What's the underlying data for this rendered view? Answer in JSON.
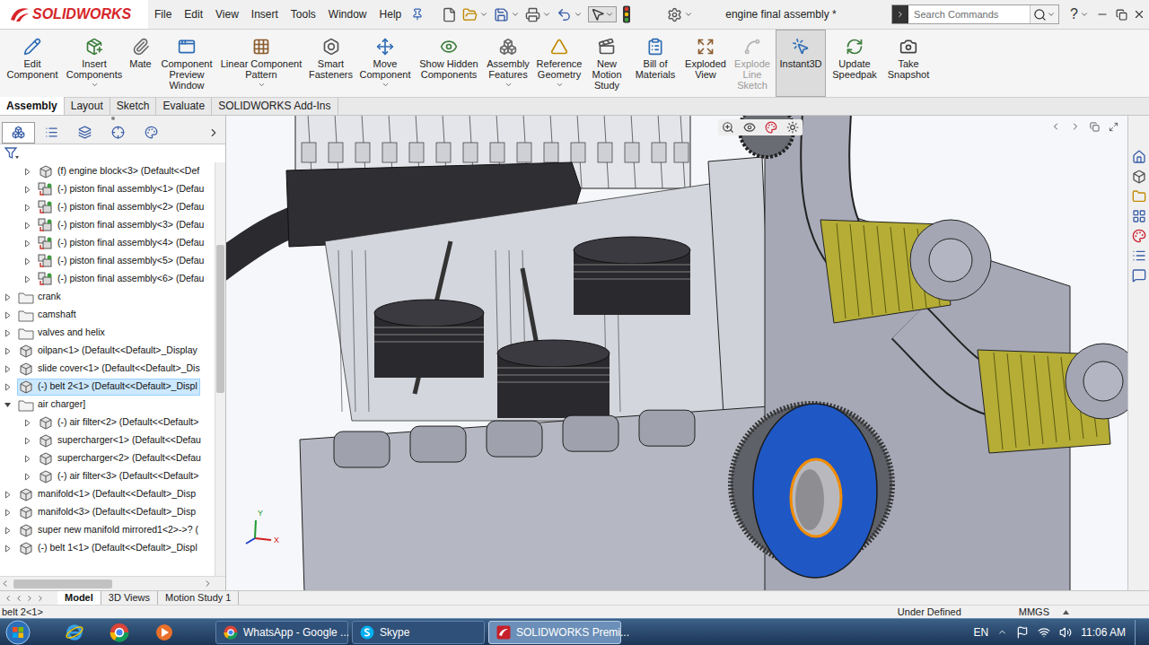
{
  "app": {
    "logo": "SOLIDWORKS"
  },
  "menu": [
    "File",
    "Edit",
    "View",
    "Insert",
    "Tools",
    "Window",
    "Help"
  ],
  "window": {
    "title": "engine final assembly *"
  },
  "search": {
    "placeholder": "Search Commands"
  },
  "help": "?",
  "ribbon": [
    {
      "label": "Edit Component",
      "dropdown": false,
      "disabled": false,
      "selected": false
    },
    {
      "label": "Insert Components",
      "dropdown": true,
      "disabled": false,
      "selected": false
    },
    {
      "label": "Mate",
      "dropdown": false,
      "disabled": false,
      "selected": false
    },
    {
      "label": "Component Preview Window",
      "dropdown": false,
      "disabled": false,
      "selected": false
    },
    {
      "label": "Linear Component Pattern",
      "dropdown": true,
      "disabled": false,
      "selected": false
    },
    {
      "label": "Smart Fasteners",
      "dropdown": false,
      "disabled": false,
      "selected": false
    },
    {
      "label": "Move Component",
      "dropdown": true,
      "disabled": false,
      "selected": false
    },
    {
      "label": "Show Hidden Components",
      "dropdown": false,
      "disabled": false,
      "selected": false
    },
    {
      "label": "Assembly Features",
      "dropdown": true,
      "disabled": false,
      "selected": false
    },
    {
      "label": "Reference Geometry",
      "dropdown": true,
      "disabled": false,
      "selected": false
    },
    {
      "label": "New Motion Study",
      "dropdown": false,
      "disabled": false,
      "selected": false
    },
    {
      "label": "Bill of Materials",
      "dropdown": false,
      "disabled": false,
      "selected": false
    },
    {
      "label": "Exploded View",
      "dropdown": false,
      "disabled": false,
      "selected": false
    },
    {
      "label": "Explode Line Sketch",
      "dropdown": false,
      "disabled": true,
      "selected": false
    },
    {
      "label": "Instant3D",
      "dropdown": false,
      "disabled": false,
      "selected": true
    },
    {
      "label": "Update Speedpak",
      "dropdown": false,
      "disabled": false,
      "selected": false
    },
    {
      "label": "Take Snapshot",
      "dropdown": false,
      "disabled": false,
      "selected": false
    }
  ],
  "command_tabs": [
    {
      "label": "Assembly",
      "selected": true
    },
    {
      "label": "Layout",
      "selected": false
    },
    {
      "label": "Sketch",
      "selected": false
    },
    {
      "label": "Evaluate",
      "selected": false
    },
    {
      "label": "SOLIDWORKS Add-Ins",
      "selected": false
    }
  ],
  "panel_tabs": [
    {
      "selected": true
    },
    {
      "selected": false
    },
    {
      "selected": false
    },
    {
      "selected": false
    },
    {
      "selected": false
    }
  ],
  "tree": {
    "scroll_level": 0.2,
    "items": [
      {
        "label": "(f) engine block<3> (Default<<Def",
        "kind": "part",
        "depth": 1,
        "expanded": false,
        "selected": false
      },
      {
        "label": "(-) piston final assembly<1> (Defau",
        "kind": "assembly",
        "depth": 1,
        "expanded": false,
        "selected": false
      },
      {
        "label": "(-) piston final assembly<2> (Defau",
        "kind": "assembly",
        "depth": 1,
        "expanded": false,
        "selected": false
      },
      {
        "label": "(-) piston final assembly<3> (Defau",
        "kind": "assembly",
        "depth": 1,
        "expanded": false,
        "selected": false
      },
      {
        "label": "(-) piston final assembly<4> (Defau",
        "kind": "assembly",
        "depth": 1,
        "expanded": false,
        "selected": false
      },
      {
        "label": "(-) piston final assembly<5> (Defau",
        "kind": "assembly",
        "depth": 1,
        "expanded": false,
        "selected": false
      },
      {
        "label": "(-) piston final assembly<6> (Defau",
        "kind": "assembly",
        "depth": 1,
        "expanded": false,
        "selected": false
      },
      {
        "label": "crank",
        "kind": "folder",
        "depth": 0,
        "expanded": false,
        "selected": false
      },
      {
        "label": "camshaft",
        "kind": "folder",
        "depth": 0,
        "expanded": false,
        "selected": false
      },
      {
        "label": "valves and helix",
        "kind": "folder",
        "depth": 0,
        "expanded": false,
        "selected": false
      },
      {
        "label": "oilpan<1> (Default<<Default>_Display",
        "kind": "part",
        "depth": 0,
        "expanded": false,
        "selected": false
      },
      {
        "label": "slide cover<1> (Default<<Default>_Dis",
        "kind": "part",
        "depth": 0,
        "expanded": false,
        "selected": false
      },
      {
        "label": "(-) belt 2<1> (Default<<Default>_Displ",
        "kind": "part",
        "depth": 0,
        "expanded": false,
        "selected": true
      },
      {
        "label": "air charger]",
        "kind": "folder",
        "depth": 0,
        "expanded": true,
        "selected": false
      },
      {
        "label": "(-) air filter<2> (Default<<Default>",
        "kind": "part",
        "depth": 1,
        "expanded": false,
        "selected": false
      },
      {
        "label": "supercharger<1> (Default<<Defau",
        "kind": "part",
        "depth": 1,
        "expanded": false,
        "selected": false
      },
      {
        "label": "supercharger<2> (Default<<Defau",
        "kind": "part",
        "depth": 1,
        "expanded": false,
        "selected": false
      },
      {
        "label": "(-) air filter<3> (Default<<Default>",
        "kind": "part",
        "depth": 1,
        "expanded": false,
        "selected": false
      },
      {
        "label": "manifold<1> (Default<<Default>_Disp",
        "kind": "part",
        "depth": 0,
        "expanded": false,
        "selected": false
      },
      {
        "label": "manifold<3> (Default<<Default>_Disp",
        "kind": "part",
        "depth": 0,
        "expanded": false,
        "selected": false
      },
      {
        "label": "super new manifold mirrored1<2>->? (",
        "kind": "part",
        "depth": 0,
        "expanded": false,
        "selected": false
      },
      {
        "label": "(-) belt 1<1> (Default<<Default>_Displ",
        "kind": "part",
        "depth": 0,
        "expanded": false,
        "selected": false
      }
    ]
  },
  "viewport": {
    "triad": {
      "y": "Y",
      "x": "X"
    }
  },
  "bottom_tabs": [
    {
      "label": "Model",
      "selected": true
    },
    {
      "label": "3D Views",
      "selected": false
    },
    {
      "label": "Motion Study 1",
      "selected": false
    }
  ],
  "status_bar": {
    "selection": "belt 2<1>",
    "state": "Under Defined",
    "units": "MMGS"
  },
  "taskbar": {
    "buttons": [
      {
        "label": "WhatsApp - Google ...",
        "selected": false
      },
      {
        "label": "Skype",
        "selected": false
      },
      {
        "label": "SOLIDWORKS Premi...",
        "selected": true
      }
    ],
    "language": "EN",
    "time": "11:06 AM"
  }
}
